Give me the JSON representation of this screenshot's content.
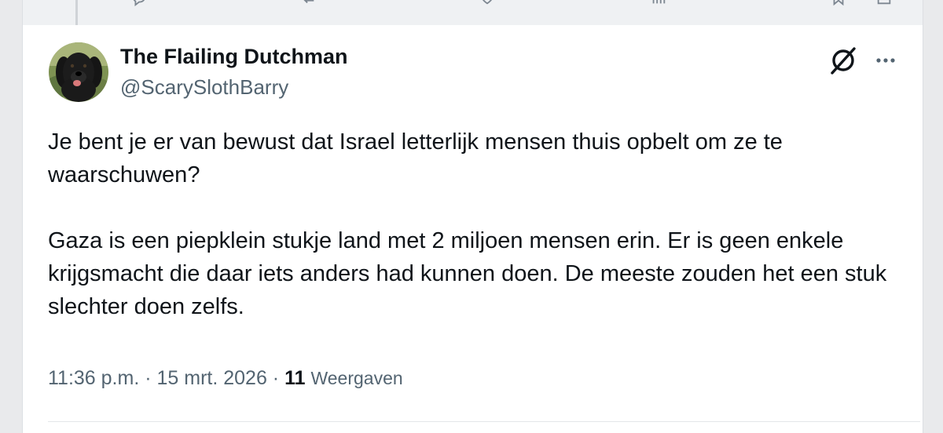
{
  "tweet": {
    "author": {
      "display_name": "The Flailing Dutchman",
      "handle": "@ScarySlothBarry",
      "avatar": "black-dog-avatar"
    },
    "paragraphs": [
      "Je bent je er van bewust dat Israel letterlijk mensen thuis opbelt om ze te waarschuwen?",
      "Gaza is een piepklein stukje land met 2 miljoen mensen erin. Er is geen enkele krijgsmacht die daar iets anders had kunnen doen. De meeste zouden het een stuk slechter doen zelfs."
    ],
    "time": "11:36 p.m.",
    "separator": " · ",
    "date": "15 mrt. 2026",
    "views_count": "11",
    "views_label": "Weergaven"
  },
  "icons": {
    "grok": "grok-icon",
    "more": "more-options-icon",
    "top_bar": [
      "reply-icon",
      "repost-icon",
      "like-icon",
      "views-icon",
      "bookmark-icon",
      "share-icon"
    ]
  },
  "colors": {
    "text_primary": "#0f1419",
    "text_secondary": "#536471",
    "background": "#ffffff"
  }
}
